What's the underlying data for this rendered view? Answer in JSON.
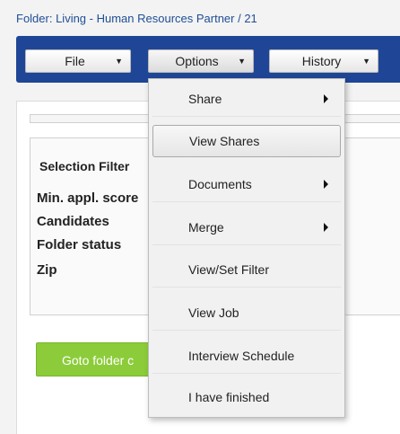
{
  "header": {
    "breadcrumb": "Folder: Living - Human Resources Partner / 21"
  },
  "toolbar": {
    "file_label": "File",
    "options_label": "Options",
    "history_label": "History"
  },
  "filter": {
    "title": "Selection Filter",
    "rows": [
      "Min. appl. score",
      "Candidates",
      "Folder status",
      "Zip"
    ]
  },
  "goto_button": "Goto folder c",
  "options_menu": {
    "items": [
      {
        "label": "Share",
        "submenu": true
      },
      {
        "label": "View Shares",
        "submenu": false,
        "highlighted": true
      },
      {
        "label": "Documents",
        "submenu": true
      },
      {
        "label": "Merge",
        "submenu": true
      },
      {
        "label": "View/Set Filter",
        "submenu": false
      },
      {
        "label": "View Job",
        "submenu": false
      },
      {
        "label": "Interview Schedule",
        "submenu": false
      },
      {
        "label": "I have finished",
        "submenu": false
      }
    ]
  },
  "colors": {
    "toolbar_bg": "#1f4696",
    "goto_button_bg": "#8ccc3a",
    "breadcrumb_text": "#1f4e96"
  }
}
